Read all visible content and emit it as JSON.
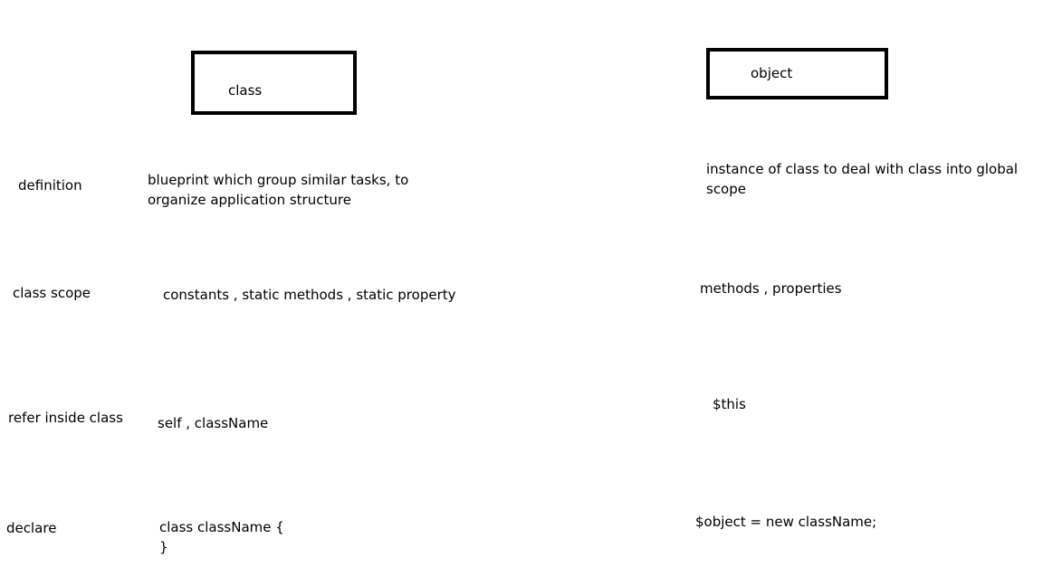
{
  "headers": {
    "class": "class",
    "object": "object"
  },
  "rows": {
    "definition": {
      "label": "definition",
      "class_line1": "blueprint which group similar tasks, to",
      "class_line2": "organize application structure",
      "object_line1": "instance of class to deal with class into global",
      "object_line2": "scope"
    },
    "class_scope": {
      "label": "class scope",
      "class_value": "constants , static methods , static property",
      "object_value": "methods , properties"
    },
    "refer_inside_class": {
      "label": "refer inside class",
      "class_value": "self , className",
      "object_value": "$this"
    },
    "declare": {
      "label": "declare",
      "class_line1": "class className {",
      "class_line2": "}",
      "object_value": "$object = new className;"
    }
  }
}
